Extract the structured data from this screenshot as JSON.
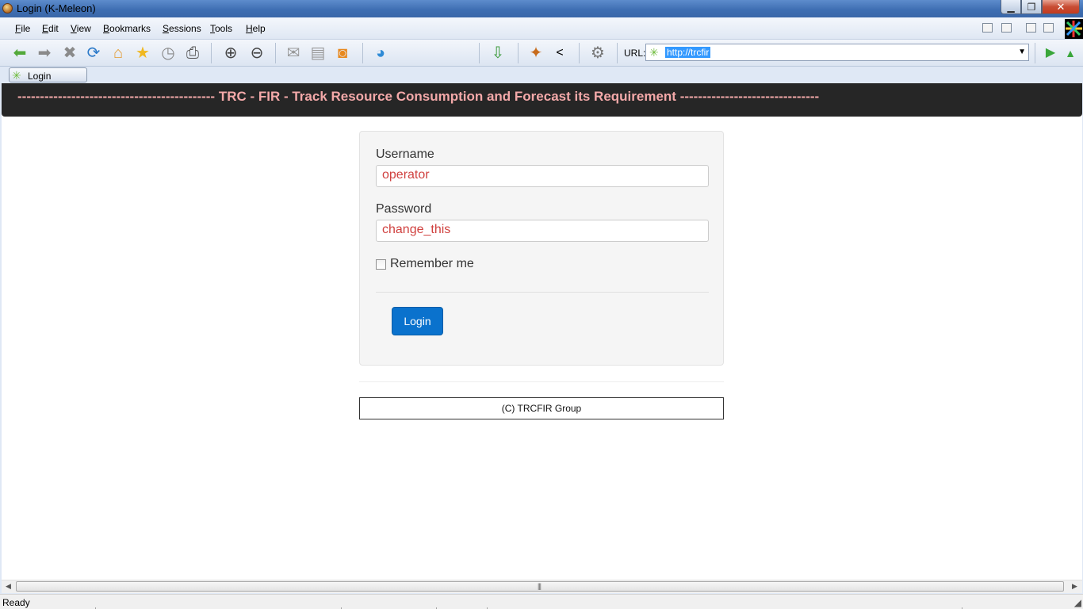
{
  "window": {
    "title": "Login (K-Meleon)",
    "min_glyph": "▁",
    "max_glyph": "❐",
    "close_glyph": "✕"
  },
  "menu": {
    "items": [
      "File",
      "Edit",
      "View",
      "Bookmarks",
      "Sessions",
      "Tools",
      "Help"
    ]
  },
  "toolbar": {
    "url_label": "URL:",
    "url_value": "http://trcfir",
    "icons": [
      "back-arrow-icon",
      "forward-arrow-icon",
      "stop-icon",
      "reload-icon",
      "home-icon",
      "bookmark-star-icon",
      "history-clock-icon",
      "print-icon",
      "zoom-in-icon",
      "zoom-out-icon",
      "mail-icon",
      "notes-icon",
      "rss-icon",
      "globe-icon",
      "download-icon",
      "privacy-icon",
      "source-icon",
      "settings-gear-icon",
      "go-arrow-icon",
      "scroll-top-icon"
    ]
  },
  "tab": {
    "label": "Login"
  },
  "page": {
    "banner": "-------------------------------------------- TRC - FIR - Track Resource Consumption and Forecast its Requirement -------------------------------",
    "username_label": "Username",
    "username_value": "operator",
    "password_label": "Password",
    "password_value": "change_this",
    "remember_label": "Remember me",
    "login_button": "Login",
    "footer": "(C) TRCFIR Group"
  },
  "status": {
    "text": "Ready"
  },
  "colors": {
    "banner_bg": "#262626",
    "banner_text": "#f4a9a9",
    "input_text": "#d0413f",
    "button_bg": "#0a72cd"
  }
}
